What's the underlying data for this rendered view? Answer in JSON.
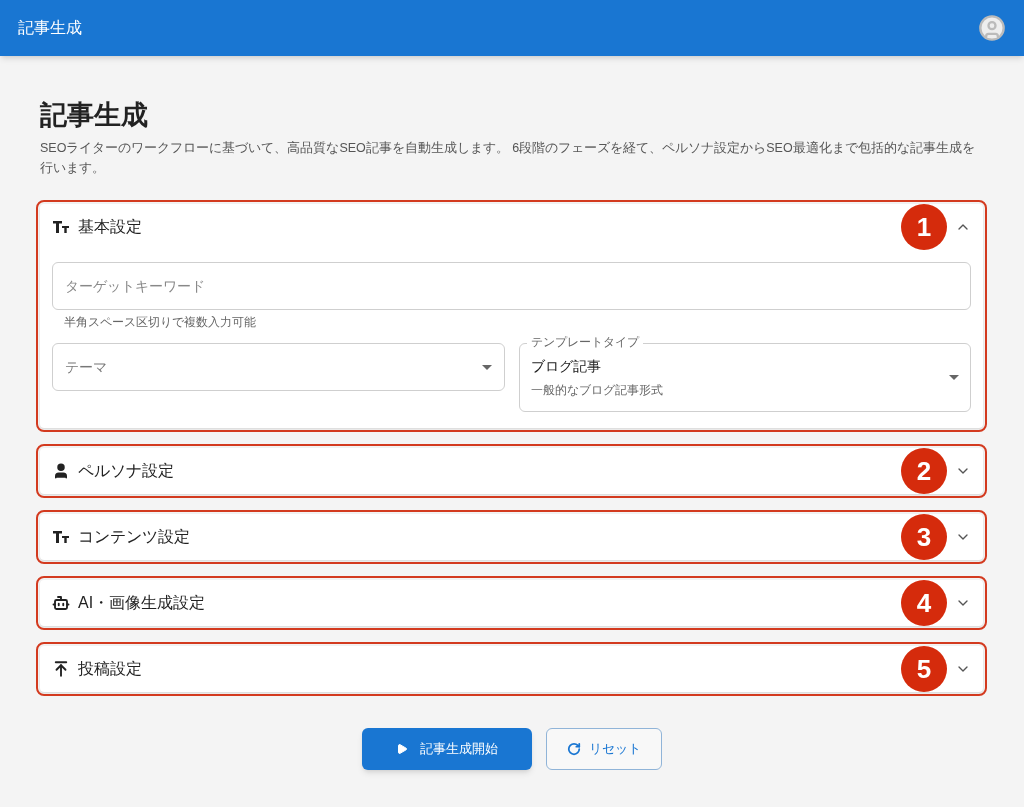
{
  "app_bar": {
    "title": "記事生成"
  },
  "page": {
    "title": "記事生成",
    "description": "SEOライターのワークフローに基づいて、高品質なSEO記事を自動生成します。 6段階のフェーズを経て、ペルソナ設定からSEO最適化まで包括的な記事生成を行います。"
  },
  "sections": [
    {
      "kind": "text",
      "title": "基本設定",
      "expanded": true,
      "callout": "1",
      "keyword_field": {
        "placeholder": "ターゲットキーワード",
        "helper": "半角スペース区切りで複数入力可能"
      },
      "theme_select": {
        "placeholder": "テーマ"
      },
      "template_select": {
        "label": "テンプレートタイプ",
        "value": "ブログ記事",
        "description": "一般的なブログ記事形式"
      }
    },
    {
      "kind": "person",
      "title": "ペルソナ設定",
      "expanded": false,
      "callout": "2"
    },
    {
      "kind": "text",
      "title": "コンテンツ設定",
      "expanded": false,
      "callout": "3"
    },
    {
      "kind": "robot",
      "title": "AI・画像生成設定",
      "expanded": false,
      "callout": "4"
    },
    {
      "kind": "upload",
      "title": "投稿設定",
      "expanded": false,
      "callout": "5"
    }
  ],
  "buttons": [
    {
      "kind": "primary",
      "label": "記事生成開始"
    },
    {
      "kind": "secondary",
      "label": "リセット"
    }
  ]
}
